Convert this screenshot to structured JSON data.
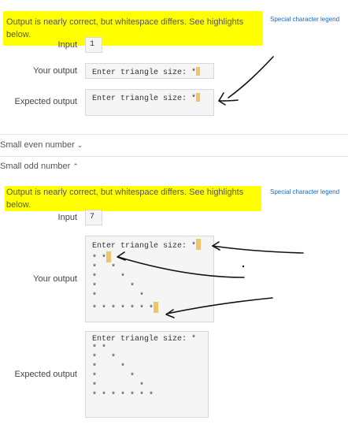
{
  "banner_1": {
    "text": "Output is nearly correct, but whitespace differs. See highlights below.",
    "legend": "Special character legend"
  },
  "test1": {
    "input_label": "Input",
    "input_value": "1",
    "your_output_label": "Your output",
    "your_output_text": "Enter triangle size: *",
    "expected_output_label": "Expected output",
    "expected_output_text": "Enter triangle size: *"
  },
  "section_even": {
    "label": "Small even number"
  },
  "section_odd": {
    "label": "Small odd number"
  },
  "banner_2": {
    "text": "Output is nearly correct, but whitespace differs. See highlights below.",
    "legend": "Special character legend"
  },
  "test2": {
    "input_label": "Input",
    "input_value": "7",
    "your_output_label": "Your output",
    "your_output_lines": [
      "Enter triangle size: *",
      "* *",
      "*   *",
      "*     *",
      "*       *",
      "*         *",
      "* * * * * * *"
    ],
    "expected_output_label": "Expected output",
    "expected_output_lines": [
      "Enter triangle size: *",
      "* *",
      "*   *",
      "*     *",
      "*       *",
      "*         *",
      "* * * * * * *"
    ]
  },
  "colors": {
    "highlight": "#ffff00",
    "whitespace_mark": "#f2c36b",
    "link": "#1a66c2"
  }
}
